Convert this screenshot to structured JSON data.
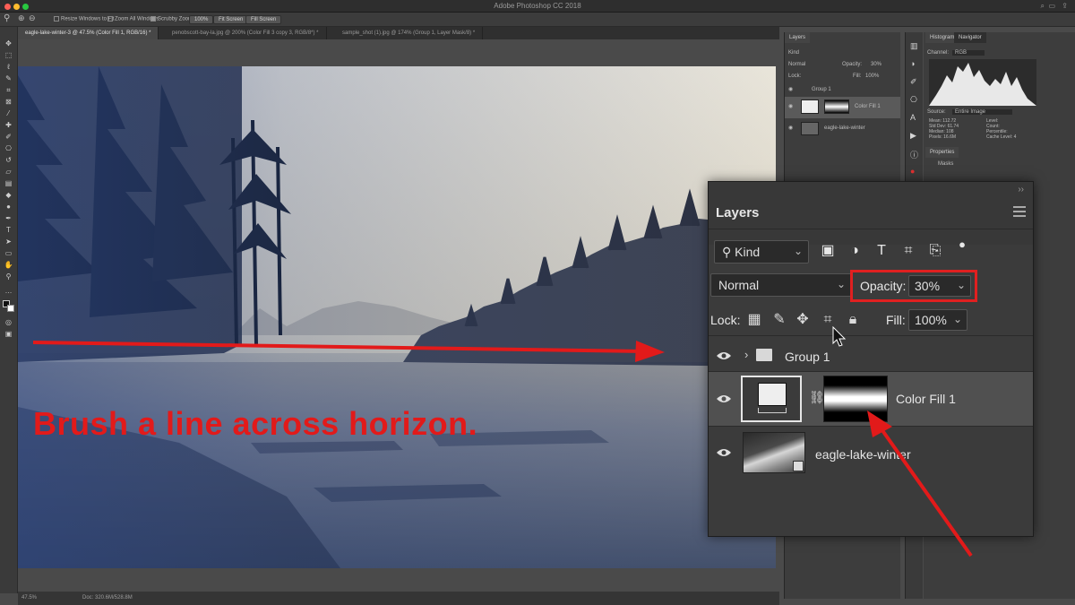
{
  "app": {
    "title": "Adobe Photoshop CC 2018"
  },
  "options_bar": {
    "resize_windows": "Resize Windows to Fit",
    "zoom_all": "Zoom All Windows",
    "scrubby_zoom": "Scrubby Zoom",
    "zoom_value": "100%",
    "fit_screen": "Fit Screen",
    "fill_screen": "Fill Screen"
  },
  "tabs": [
    {
      "label": "eagle-lake-winter-3 @ 47.5% (Color Fill 1, RGB/16) *"
    },
    {
      "label": "penobscott-bay-la.jpg @ 200% (Color Fill 3 copy 3, RGB/8*) *"
    },
    {
      "label": "sample_shot (1).jpg @ 174% (Group 1, Layer Mask/8) *"
    }
  ],
  "status_bar": {
    "zoom": "47.5%",
    "doc": "Doc: 320.6M/528.8M"
  },
  "annotation": {
    "text": "Brush a line across horizon.",
    "color": "#e21a1a"
  },
  "small_layers_panel": {
    "tab": "Layers",
    "kind": "Kind",
    "blend": "Normal",
    "opacity_label": "Opacity:",
    "opacity_value": "30%",
    "lock_label": "Lock:",
    "fill_label": "Fill:",
    "fill_value": "100%",
    "layers": [
      "Group 1",
      "Color Fill 1",
      "eagle-lake-winter"
    ]
  },
  "histogram_panel": {
    "tabs": [
      "Histogram",
      "Navigator"
    ],
    "channel_label": "Channel:",
    "channel_value": "RGB",
    "source_label": "Source:",
    "source_value": "Entire Image",
    "stats": [
      "Mean: 112.72",
      "Std Dev: 61.74",
      "Median: 108",
      "Pixels: 16.6M"
    ],
    "stats_right": [
      "Level:",
      "Count:",
      "Percentile:",
      "Cache Level: 4"
    ]
  },
  "properties_panel": {
    "tab": "Properties",
    "section": "Masks"
  },
  "layers_panel": {
    "title": "Layers",
    "kind_label": "Kind",
    "blend_mode": "Normal",
    "opacity_label": "Opacity:",
    "opacity_value": "30%",
    "lock_label": "Lock:",
    "fill_label": "Fill:",
    "fill_value": "100%",
    "layers": [
      {
        "name": "Group 1"
      },
      {
        "name": "Color Fill 1"
      },
      {
        "name": "eagle-lake-winter"
      }
    ],
    "highlight_color": "#e02020"
  }
}
